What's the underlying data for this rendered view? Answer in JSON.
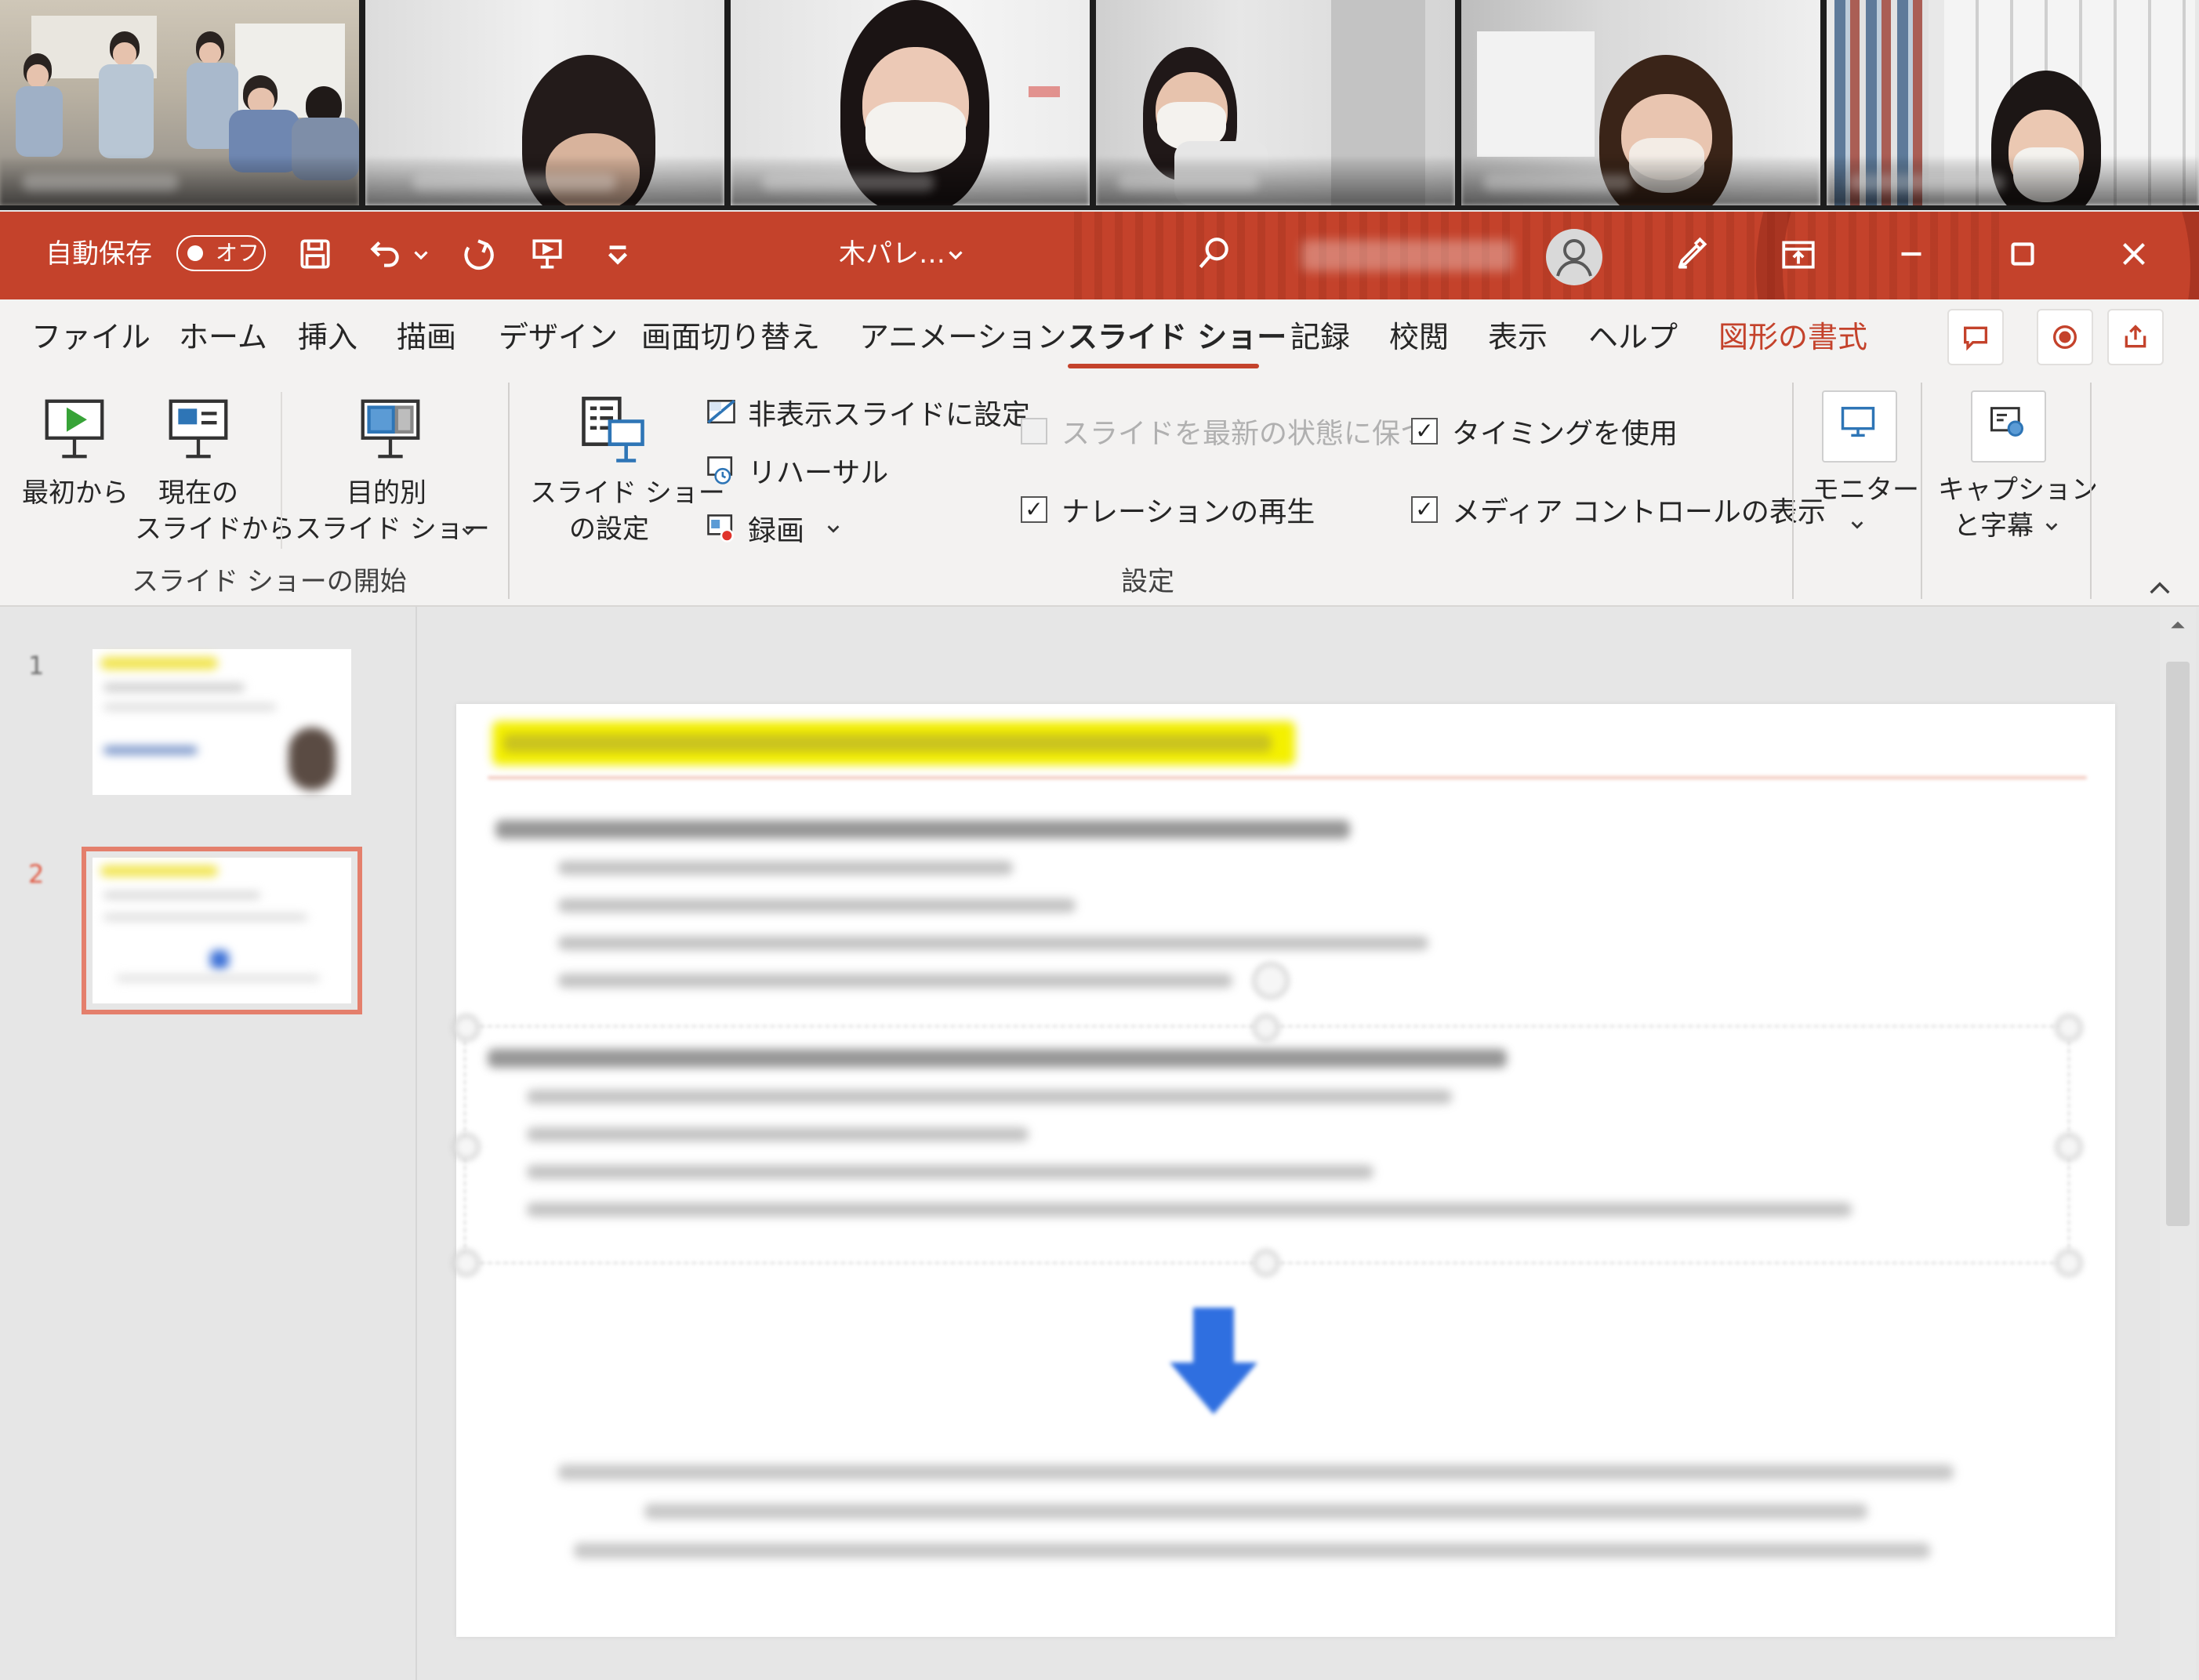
{
  "titlebar": {
    "autosave_label": "自動保存",
    "autosave_state": "オフ",
    "document_title": "木パレ…",
    "colors": {
      "accent": "#c4422b"
    }
  },
  "tabs": [
    {
      "label": "ファイル"
    },
    {
      "label": "ホーム"
    },
    {
      "label": "挿入"
    },
    {
      "label": "描画"
    },
    {
      "label": "デザイン"
    },
    {
      "label": "画面切り替え"
    },
    {
      "label": "アニメーション"
    },
    {
      "label": "スライド ショー",
      "active": true
    },
    {
      "label": "記録"
    },
    {
      "label": "校閲"
    },
    {
      "label": "表示"
    },
    {
      "label": "ヘルプ"
    },
    {
      "label": "図形の書式"
    }
  ],
  "ribbon": {
    "start_group": {
      "label": "スライド ショーの開始",
      "from_beginning": "最初から",
      "from_current_1": "現在の",
      "from_current_2": "スライドから",
      "custom_1": "目的別",
      "custom_2": "スライド ショー"
    },
    "settings_group": {
      "label": "設定",
      "setup_1": "スライド ショー",
      "setup_2": "の設定",
      "hide_slide": "非表示スライドに設定",
      "rehearse": "リハーサル",
      "record": "録画",
      "keep_updated": "スライドを最新の状態に保つ",
      "use_timings": "タイミングを使用",
      "play_narrations": "ナレーションの再生",
      "show_media_controls": "メディア コントロールの表示",
      "checked_mark": "✓"
    },
    "monitor": {
      "label": "モニター"
    },
    "captions": {
      "label_1": "キャプション",
      "label_2": "と字幕"
    }
  },
  "thumbnails": [
    {
      "number": "1"
    },
    {
      "number": "2",
      "selected": true
    }
  ]
}
